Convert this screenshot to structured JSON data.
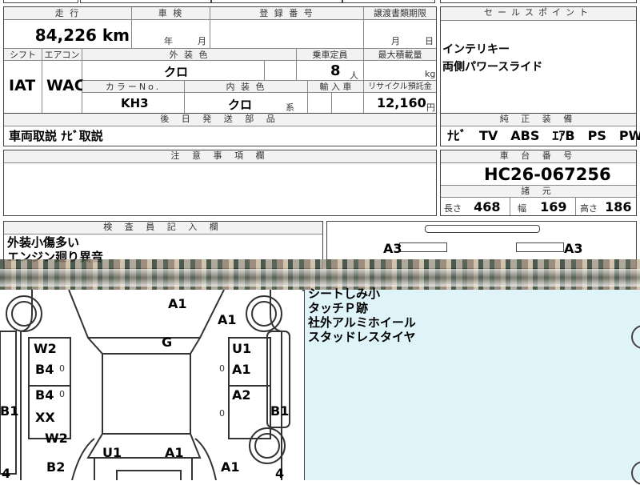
{
  "top_partial": {
    "text1": "·",
    "text2": "¨"
  },
  "spec": {
    "h_mileage": "走 行",
    "h_inspection": "車 検",
    "h_registration": "登 録 番 号",
    "h_transfer": "譲渡書類期限",
    "mileage": "84,226 km",
    "insp_year": "年",
    "insp_month": "月",
    "trans_month": "月",
    "trans_day": "日",
    "h_shift": "シフト",
    "h_aircon": "エアコン",
    "h_color": "外 装 色",
    "h_capacity": "乗車定員",
    "h_maxload": "最大積載量",
    "shift": "IAT",
    "aircon": "WAC",
    "color": "クロ",
    "capacity": "8",
    "capacity_unit": "人",
    "maxload_unit": "kg",
    "h_color_no": "カラーNo.",
    "h_interior": "内 装 色",
    "h_import": "輸 入 車",
    "h_recycle": "リサイクル預託金",
    "color_no": "KH3",
    "interior": "クロ",
    "interior_suffix": "系",
    "recycle": "12,160",
    "recycle_unit": "円",
    "h_shipping": "後 日 発 送 部 品",
    "shipping": "車両取説 ﾅﾋﾞ取説",
    "h_notes": "注 意 事 項 欄"
  },
  "sales": {
    "h_sales": "セールスポイント",
    "points": [
      "インテリキー",
      "両側パワースライド"
    ],
    "h_equipment": "純 正 装 備",
    "equipment": "ﾅﾋﾞ　TV　ABS　ｴｱB　PS　PW",
    "h_chassis": "車 台 番 号",
    "chassis": "HC26-067256",
    "h_dims": "諸 元",
    "len_label": "長さ",
    "len": "468",
    "wid_label": "幅",
    "wid": "169",
    "hei_label": "高さ",
    "hei": "186"
  },
  "inspector": {
    "h_inspector": "検 査 員 記 入 欄",
    "lines_top": [
      "外装小傷多い",
      "エンジン廻り異音"
    ],
    "lines_bottom": [
      "シートしみ小",
      "タッチＰ跡",
      "社外アルミホイール",
      "スタッドレスタイヤ"
    ]
  },
  "diagram_marks": {
    "top_left": "A3",
    "top_right": "A3",
    "front_a1": "A1",
    "front_right_a1": "A1",
    "center_g": "G",
    "w2_upper": "W2",
    "b4_upper": "B4",
    "u1_right": "U1",
    "a1_right": "A1",
    "b4_lower": "B4",
    "xx": "XX",
    "a2_right": "A2",
    "b1_left": "B1",
    "b1_right": "B1",
    "w2_lower": "W2",
    "b2": "B2",
    "u1_bottom": "U1",
    "a1_bottom": "A1",
    "a1_bottom_right": "A1",
    "tire_left": "0",
    "tire_right": "0",
    "tire_left2": "0",
    "tire_right2": "0",
    "edge_left": "4",
    "edge_right": "4"
  },
  "colors": {
    "inspector_bg": "#dff4f9",
    "header_bg": "#f2f2f2",
    "border": "#444444"
  }
}
